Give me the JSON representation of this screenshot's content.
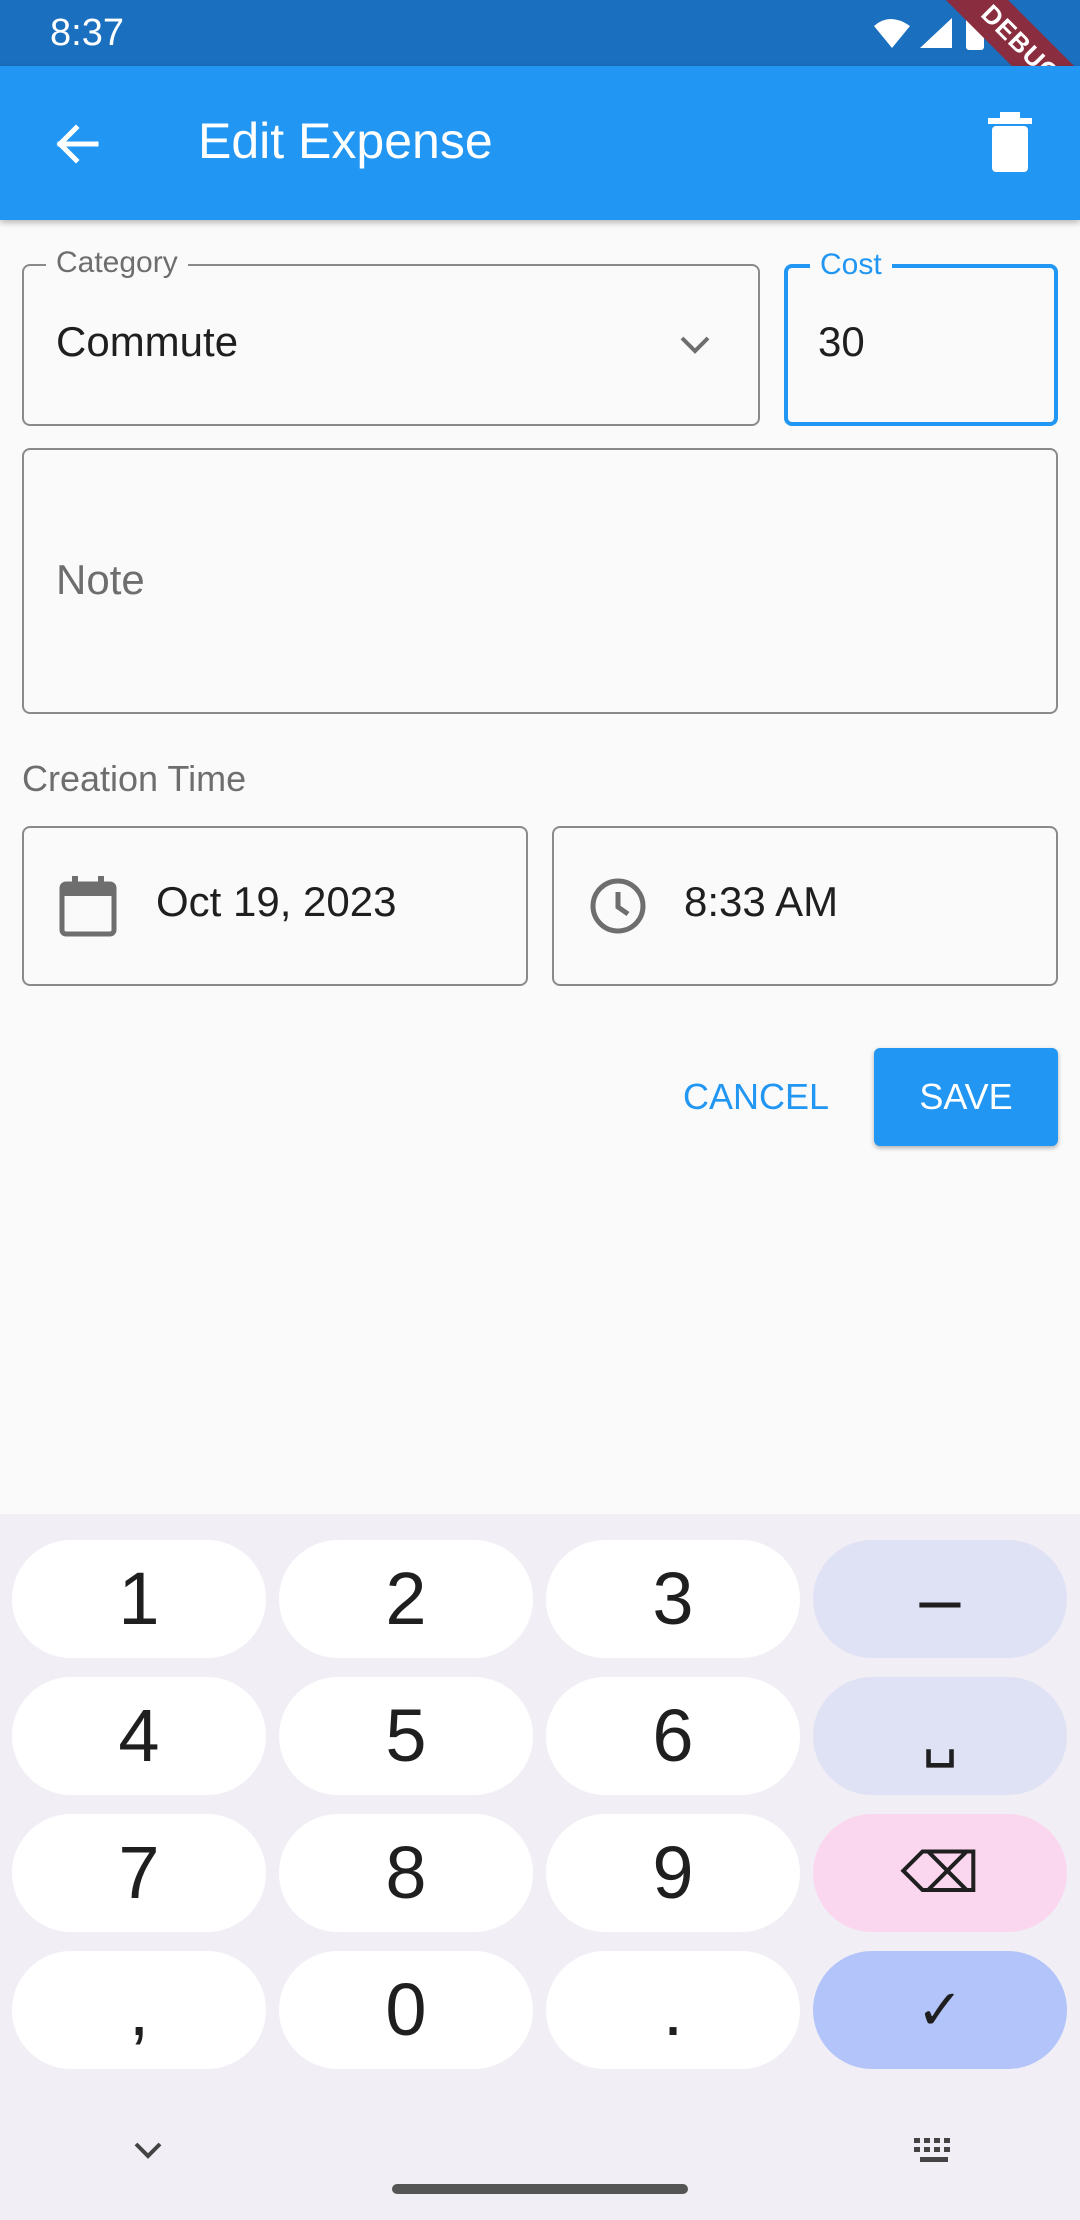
{
  "status_bar": {
    "time": "8:37",
    "debug_label": "DEBUG"
  },
  "app_bar": {
    "title": "Edit Expense",
    "back_icon": "arrow-back-icon",
    "delete_icon": "trash-icon"
  },
  "form": {
    "category": {
      "label": "Category",
      "value": "Commute"
    },
    "cost": {
      "label": "Cost",
      "value": "30"
    },
    "note": {
      "placeholder": "Note",
      "value": ""
    },
    "creation_time": {
      "label": "Creation Time",
      "date": "Oct 19, 2023",
      "time": "8:33 AM"
    }
  },
  "actions": {
    "cancel": "CANCEL",
    "save": "SAVE"
  },
  "keyboard": {
    "keys": [
      "1",
      "2",
      "3",
      "–",
      "4",
      "5",
      "6",
      "␣",
      "7",
      "8",
      "9",
      "⌫",
      ",",
      "0",
      ".",
      "✓"
    ]
  },
  "colors": {
    "primary": "#2196f3",
    "status_bar": "#1a6fbe",
    "debug": "#8a2d3e"
  }
}
